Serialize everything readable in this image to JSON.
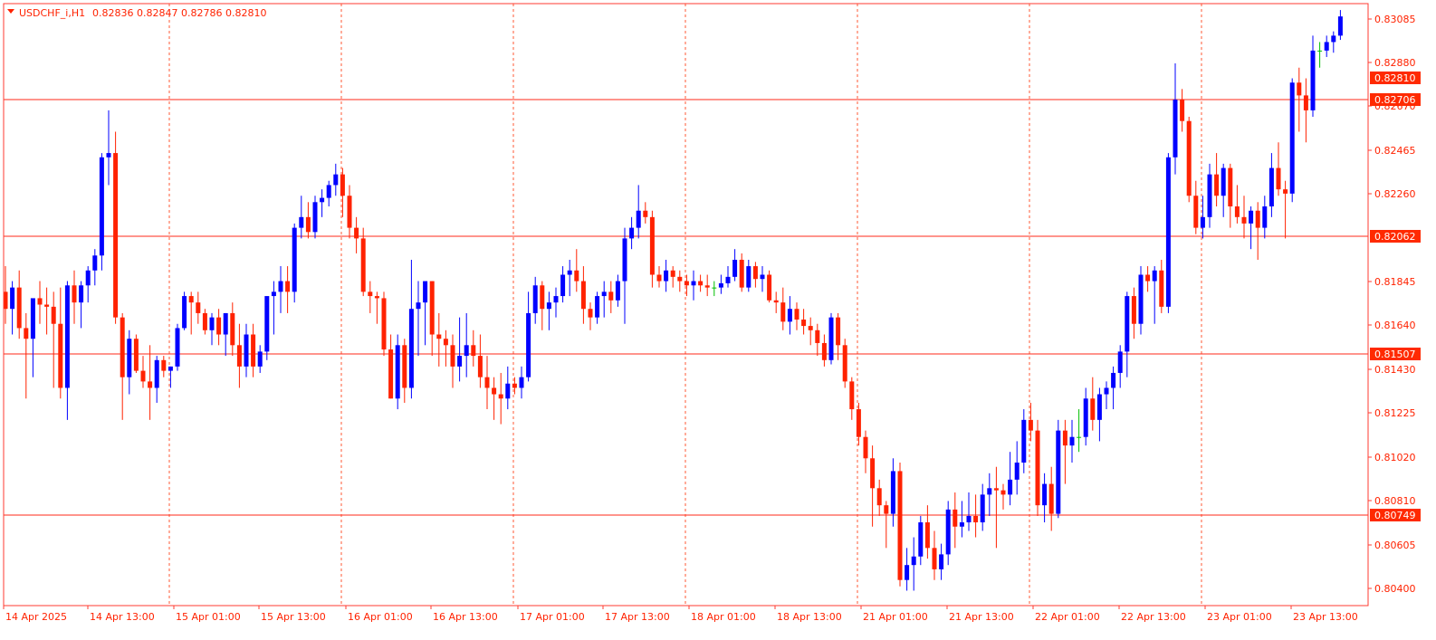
{
  "window": {
    "symbol_label": "USDCHF_i,H1",
    "ohlc_label": "0.82836 0.82847 0.82786 0.82810"
  },
  "colors": {
    "background": "#ffffff",
    "frame": "#ff3b30",
    "bull": "#0000ff",
    "bear": "#ff2200",
    "doji": "#00c000",
    "level_line": "#ff2a1a",
    "separator": "#ff5a36",
    "axis_text": "#ff2200",
    "label_bg": "#ff2a00",
    "label_text": "#ffffff"
  },
  "chart_data": {
    "type": "candlestick",
    "title": "USDCHF_i,H1",
    "ylim": [
      0.8033,
      0.8315
    ],
    "y_ticks": [
      "0.83085",
      "0.82880",
      "0.82670",
      "0.82465",
      "0.82260",
      "0.81845",
      "0.81640",
      "0.81430",
      "0.81225",
      "0.81020",
      "0.80810",
      "0.80605",
      "0.80400"
    ],
    "x_labels": [
      "14 Apr 2025",
      "14 Apr 13:00",
      "15 Apr 01:00",
      "15 Apr 13:00",
      "16 Apr 01:00",
      "16 Apr 13:00",
      "17 Apr 01:00",
      "17 Apr 13:00",
      "18 Apr 01:00",
      "18 Apr 13:00",
      "21 Apr 01:00",
      "21 Apr 13:00",
      "22 Apr 01:00",
      "22 Apr 13:00",
      "23 Apr 01:00",
      "23 Apr 13:00"
    ],
    "horizontal_levels": [
      "0.82810",
      "0.82706",
      "0.82062",
      "0.81507",
      "0.80749"
    ],
    "current_price": "0.82810",
    "candles": [
      [
        0.818,
        0.8192,
        0.8165,
        0.8172
      ],
      [
        0.8172,
        0.8185,
        0.816,
        0.8182
      ],
      [
        0.8182,
        0.819,
        0.8158,
        0.8163
      ],
      [
        0.8163,
        0.817,
        0.813,
        0.8158
      ],
      [
        0.8158,
        0.8175,
        0.814,
        0.8177
      ],
      [
        0.8177,
        0.8185,
        0.8165,
        0.8174
      ],
      [
        0.8174,
        0.8182,
        0.816,
        0.8173
      ],
      [
        0.8173,
        0.818,
        0.8135,
        0.8165
      ],
      [
        0.8165,
        0.8182,
        0.813,
        0.8135
      ],
      [
        0.8135,
        0.8185,
        0.812,
        0.8183
      ],
      [
        0.8183,
        0.819,
        0.8165,
        0.8175
      ],
      [
        0.8175,
        0.8185,
        0.8163,
        0.8183
      ],
      [
        0.8183,
        0.8192,
        0.8175,
        0.819
      ],
      [
        0.819,
        0.82,
        0.8183,
        0.8197
      ],
      [
        0.8197,
        0.8245,
        0.819,
        0.8243
      ],
      [
        0.8243,
        0.8265,
        0.823,
        0.8245
      ],
      [
        0.8245,
        0.8255,
        0.8165,
        0.8168
      ],
      [
        0.8168,
        0.817,
        0.812,
        0.814
      ],
      [
        0.814,
        0.8162,
        0.8132,
        0.8158
      ],
      [
        0.8158,
        0.816,
        0.8142,
        0.8143
      ],
      [
        0.8143,
        0.815,
        0.8135,
        0.8138
      ],
      [
        0.8138,
        0.8155,
        0.812,
        0.8135
      ],
      [
        0.8135,
        0.815,
        0.8128,
        0.8148
      ],
      [
        0.8148,
        0.815,
        0.814,
        0.8143
      ],
      [
        0.8143,
        0.8145,
        0.8135,
        0.8145
      ],
      [
        0.8145,
        0.8165,
        0.8143,
        0.8163
      ],
      [
        0.8163,
        0.818,
        0.8162,
        0.8178
      ],
      [
        0.8178,
        0.818,
        0.816,
        0.8175
      ],
      [
        0.8175,
        0.818,
        0.8165,
        0.817
      ],
      [
        0.817,
        0.8172,
        0.816,
        0.8162
      ],
      [
        0.8162,
        0.817,
        0.8155,
        0.8168
      ],
      [
        0.8168,
        0.8172,
        0.8155,
        0.816
      ],
      [
        0.816,
        0.817,
        0.815,
        0.817
      ],
      [
        0.817,
        0.8175,
        0.815,
        0.8155
      ],
      [
        0.8155,
        0.8165,
        0.8135,
        0.8145
      ],
      [
        0.8145,
        0.8165,
        0.814,
        0.816
      ],
      [
        0.816,
        0.8165,
        0.814,
        0.8145
      ],
      [
        0.8145,
        0.8155,
        0.8142,
        0.8152
      ],
      [
        0.8152,
        0.8175,
        0.8148,
        0.8178
      ],
      [
        0.8178,
        0.8185,
        0.816,
        0.818
      ],
      [
        0.818,
        0.8192,
        0.817,
        0.8185
      ],
      [
        0.8185,
        0.8192,
        0.817,
        0.818
      ],
      [
        0.818,
        0.8212,
        0.8175,
        0.821
      ],
      [
        0.821,
        0.8225,
        0.8205,
        0.8215
      ],
      [
        0.8215,
        0.8222,
        0.8205,
        0.8208
      ],
      [
        0.8208,
        0.8225,
        0.8205,
        0.8222
      ],
      [
        0.8222,
        0.8228,
        0.8215,
        0.8224
      ],
      [
        0.8224,
        0.8232,
        0.822,
        0.823
      ],
      [
        0.823,
        0.824,
        0.8225,
        0.8235
      ],
      [
        0.8235,
        0.8238,
        0.8215,
        0.8225
      ],
      [
        0.8225,
        0.823,
        0.8205,
        0.821
      ],
      [
        0.821,
        0.8215,
        0.8198,
        0.8205
      ],
      [
        0.8205,
        0.821,
        0.8178,
        0.818
      ],
      [
        0.818,
        0.8185,
        0.817,
        0.8178
      ],
      [
        0.8178,
        0.818,
        0.8165,
        0.8177
      ],
      [
        0.8177,
        0.818,
        0.815,
        0.8153
      ],
      [
        0.8153,
        0.816,
        0.813,
        0.813
      ],
      [
        0.813,
        0.816,
        0.8125,
        0.8155
      ],
      [
        0.8155,
        0.8158,
        0.8128,
        0.8135
      ],
      [
        0.8135,
        0.8195,
        0.813,
        0.8172
      ],
      [
        0.8172,
        0.8185,
        0.815,
        0.8175
      ],
      [
        0.8175,
        0.8182,
        0.8155,
        0.8185
      ],
      [
        0.8185,
        0.8185,
        0.815,
        0.816
      ],
      [
        0.816,
        0.817,
        0.8145,
        0.8158
      ],
      [
        0.8158,
        0.8162,
        0.8145,
        0.8155
      ],
      [
        0.8155,
        0.816,
        0.8135,
        0.8145
      ],
      [
        0.8145,
        0.8168,
        0.8138,
        0.815
      ],
      [
        0.815,
        0.817,
        0.814,
        0.8155
      ],
      [
        0.8155,
        0.8162,
        0.8145,
        0.815
      ],
      [
        0.815,
        0.816,
        0.8135,
        0.814
      ],
      [
        0.814,
        0.815,
        0.8125,
        0.8135
      ],
      [
        0.8135,
        0.814,
        0.812,
        0.8132
      ],
      [
        0.8132,
        0.8142,
        0.8118,
        0.813
      ],
      [
        0.813,
        0.8145,
        0.8125,
        0.8137
      ],
      [
        0.8137,
        0.814,
        0.8132,
        0.8135
      ],
      [
        0.8135,
        0.8145,
        0.813,
        0.814
      ],
      [
        0.814,
        0.818,
        0.8138,
        0.817
      ],
      [
        0.817,
        0.8187,
        0.8165,
        0.8183
      ],
      [
        0.8183,
        0.8185,
        0.8162,
        0.8172
      ],
      [
        0.8172,
        0.818,
        0.8162,
        0.8175
      ],
      [
        0.8175,
        0.8182,
        0.8168,
        0.8178
      ],
      [
        0.8178,
        0.8192,
        0.8175,
        0.8188
      ],
      [
        0.8188,
        0.8195,
        0.8178,
        0.819
      ],
      [
        0.819,
        0.82,
        0.818,
        0.8185
      ],
      [
        0.8185,
        0.8192,
        0.8165,
        0.8172
      ],
      [
        0.8172,
        0.8175,
        0.8162,
        0.8168
      ],
      [
        0.8168,
        0.818,
        0.8165,
        0.8178
      ],
      [
        0.8178,
        0.8185,
        0.8168,
        0.818
      ],
      [
        0.818,
        0.8185,
        0.817,
        0.8176
      ],
      [
        0.8176,
        0.8188,
        0.8173,
        0.8185
      ],
      [
        0.8185,
        0.821,
        0.8165,
        0.8205
      ],
      [
        0.8205,
        0.8215,
        0.82,
        0.821
      ],
      [
        0.821,
        0.823,
        0.8205,
        0.8218
      ],
      [
        0.8218,
        0.8222,
        0.8212,
        0.8215
      ],
      [
        0.8215,
        0.8218,
        0.8182,
        0.8188
      ],
      [
        0.8188,
        0.8192,
        0.8182,
        0.8185
      ],
      [
        0.8185,
        0.8195,
        0.818,
        0.819
      ],
      [
        0.819,
        0.8192,
        0.8182,
        0.8187
      ],
      [
        0.8187,
        0.819,
        0.818,
        0.8185
      ],
      [
        0.8185,
        0.8188,
        0.8178,
        0.8183
      ],
      [
        0.8183,
        0.819,
        0.8176,
        0.8185
      ],
      [
        0.8185,
        0.8188,
        0.818,
        0.8183
      ],
      [
        0.8183,
        0.8188,
        0.8178,
        0.8182
      ],
      [
        0.8182,
        0.8185,
        0.8178,
        0.8182
      ],
      [
        0.8182,
        0.8188,
        0.8179,
        0.8184
      ],
      [
        0.8184,
        0.8192,
        0.8182,
        0.8187
      ],
      [
        0.8187,
        0.82,
        0.8185,
        0.8195
      ],
      [
        0.8195,
        0.8198,
        0.818,
        0.8182
      ],
      [
        0.8182,
        0.8195,
        0.818,
        0.8192
      ],
      [
        0.8192,
        0.8194,
        0.8182,
        0.8186
      ],
      [
        0.8186,
        0.8192,
        0.818,
        0.8188
      ],
      [
        0.8188,
        0.819,
        0.8175,
        0.8176
      ],
      [
        0.8176,
        0.818,
        0.817,
        0.8175
      ],
      [
        0.8175,
        0.8182,
        0.8162,
        0.8166
      ],
      [
        0.8166,
        0.8178,
        0.816,
        0.8172
      ],
      [
        0.8172,
        0.8175,
        0.8162,
        0.8167
      ],
      [
        0.8167,
        0.8172,
        0.816,
        0.8164
      ],
      [
        0.8164,
        0.8168,
        0.8155,
        0.8162
      ],
      [
        0.8162,
        0.8165,
        0.815,
        0.8156
      ],
      [
        0.8156,
        0.816,
        0.8145,
        0.8148
      ],
      [
        0.8148,
        0.817,
        0.8146,
        0.8168
      ],
      [
        0.8168,
        0.817,
        0.8148,
        0.8155
      ],
      [
        0.8155,
        0.8158,
        0.8135,
        0.8138
      ],
      [
        0.8138,
        0.814,
        0.812,
        0.8125
      ],
      [
        0.8125,
        0.8128,
        0.8108,
        0.8112
      ],
      [
        0.8112,
        0.8115,
        0.8095,
        0.8102
      ],
      [
        0.8102,
        0.8108,
        0.807,
        0.8088
      ],
      [
        0.8088,
        0.8092,
        0.8075,
        0.808
      ],
      [
        0.808,
        0.8082,
        0.806,
        0.8076
      ],
      [
        0.8076,
        0.8102,
        0.807,
        0.8096
      ],
      [
        0.8096,
        0.81,
        0.8042,
        0.8045
      ],
      [
        0.8045,
        0.806,
        0.804,
        0.8052
      ],
      [
        0.8052,
        0.8065,
        0.804,
        0.8056
      ],
      [
        0.8056,
        0.8075,
        0.8052,
        0.8072
      ],
      [
        0.8072,
        0.808,
        0.8055,
        0.806
      ],
      [
        0.806,
        0.8068,
        0.8045,
        0.805
      ],
      [
        0.805,
        0.8062,
        0.8045,
        0.8057
      ],
      [
        0.8057,
        0.8082,
        0.8052,
        0.8078
      ],
      [
        0.8078,
        0.8086,
        0.806,
        0.807
      ],
      [
        0.807,
        0.8082,
        0.8065,
        0.8072
      ],
      [
        0.8072,
        0.8086,
        0.8068,
        0.8075
      ],
      [
        0.8075,
        0.8085,
        0.8065,
        0.8072
      ],
      [
        0.8072,
        0.809,
        0.8068,
        0.8085
      ],
      [
        0.8085,
        0.8095,
        0.8075,
        0.8088
      ],
      [
        0.8088,
        0.8098,
        0.806,
        0.8087
      ],
      [
        0.8087,
        0.809,
        0.8078,
        0.8085
      ],
      [
        0.8085,
        0.8105,
        0.808,
        0.8092
      ],
      [
        0.8092,
        0.811,
        0.8085,
        0.81
      ],
      [
        0.81,
        0.8125,
        0.8095,
        0.812
      ],
      [
        0.812,
        0.8128,
        0.811,
        0.8115
      ],
      [
        0.8115,
        0.812,
        0.8075,
        0.808
      ],
      [
        0.808,
        0.8095,
        0.8072,
        0.809
      ],
      [
        0.809,
        0.8098,
        0.8068,
        0.8076
      ],
      [
        0.8076,
        0.812,
        0.8074,
        0.8115
      ],
      [
        0.8115,
        0.812,
        0.809,
        0.8108
      ],
      [
        0.8108,
        0.812,
        0.81,
        0.8112
      ],
      [
        0.8112,
        0.8125,
        0.8105,
        0.8112
      ],
      [
        0.8112,
        0.8135,
        0.8108,
        0.813
      ],
      [
        0.813,
        0.814,
        0.8115,
        0.812
      ],
      [
        0.812,
        0.8135,
        0.811,
        0.8132
      ],
      [
        0.8132,
        0.8138,
        0.8125,
        0.8135
      ],
      [
        0.8135,
        0.8145,
        0.8125,
        0.8142
      ],
      [
        0.8142,
        0.8155,
        0.8135,
        0.8152
      ],
      [
        0.8152,
        0.818,
        0.814,
        0.8178
      ],
      [
        0.8178,
        0.8182,
        0.8158,
        0.8165
      ],
      [
        0.8165,
        0.8192,
        0.816,
        0.8188
      ],
      [
        0.8188,
        0.8192,
        0.818,
        0.8185
      ],
      [
        0.8185,
        0.8192,
        0.8165,
        0.819
      ],
      [
        0.819,
        0.8195,
        0.817,
        0.8173
      ],
      [
        0.8173,
        0.8245,
        0.817,
        0.8243
      ],
      [
        0.8243,
        0.8287,
        0.8235,
        0.827
      ],
      [
        0.827,
        0.8275,
        0.8255,
        0.826
      ],
      [
        0.826,
        0.8262,
        0.8222,
        0.8225
      ],
      [
        0.8225,
        0.8232,
        0.8207,
        0.821
      ],
      [
        0.821,
        0.8225,
        0.8205,
        0.8215
      ],
      [
        0.8215,
        0.824,
        0.821,
        0.8235
      ],
      [
        0.8235,
        0.8245,
        0.822,
        0.8225
      ],
      [
        0.8225,
        0.824,
        0.8215,
        0.8238
      ],
      [
        0.8238,
        0.824,
        0.821,
        0.822
      ],
      [
        0.822,
        0.823,
        0.8212,
        0.8215
      ],
      [
        0.8215,
        0.8225,
        0.8205,
        0.8212
      ],
      [
        0.8212,
        0.822,
        0.82,
        0.8218
      ],
      [
        0.8218,
        0.8222,
        0.8195,
        0.821
      ],
      [
        0.821,
        0.8225,
        0.8205,
        0.822
      ],
      [
        0.822,
        0.8245,
        0.8215,
        0.8238
      ],
      [
        0.8238,
        0.825,
        0.8225,
        0.8228
      ],
      [
        0.8228,
        0.8232,
        0.8205,
        0.8226
      ],
      [
        0.8226,
        0.828,
        0.8222,
        0.8278
      ],
      [
        0.8278,
        0.8285,
        0.8255,
        0.8272
      ],
      [
        0.8272,
        0.828,
        0.825,
        0.8265
      ],
      [
        0.8265,
        0.83,
        0.8262,
        0.8293
      ],
      [
        0.8293,
        0.8297,
        0.8285,
        0.8293
      ],
      [
        0.8293,
        0.83,
        0.829,
        0.8297
      ],
      [
        0.8297,
        0.8302,
        0.8292,
        0.83
      ],
      [
        0.83,
        0.8312,
        0.8298,
        0.8309
      ]
    ]
  }
}
